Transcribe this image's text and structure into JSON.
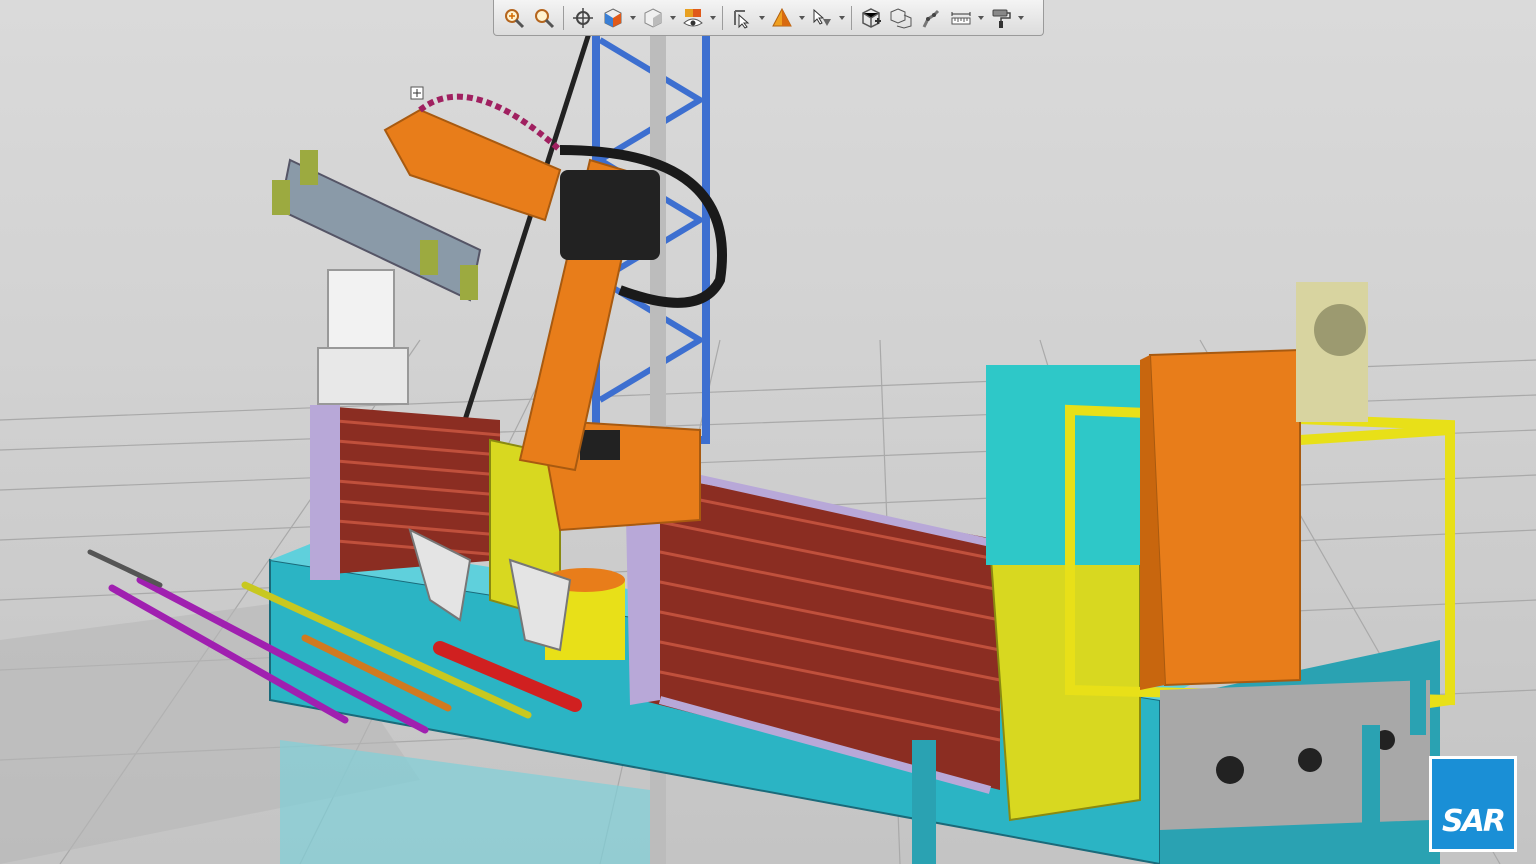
{
  "toolbar": {
    "buttons": [
      {
        "icon": "zoom-fit-icon"
      },
      {
        "icon": "zoom-icon"
      },
      {
        "icon": "center-view-icon"
      },
      {
        "icon": "view-cube-icon"
      },
      {
        "icon": "shading-cube-icon"
      },
      {
        "icon": "visibility-eye-icon"
      },
      {
        "icon": "select-pointer-icon"
      },
      {
        "icon": "render-cone-icon"
      },
      {
        "icon": "pick-filter-icon"
      },
      {
        "icon": "section-box-icon"
      },
      {
        "icon": "explode-box-icon"
      },
      {
        "icon": "robot-icon"
      },
      {
        "icon": "measure-ruler-icon"
      },
      {
        "icon": "paint-roller-icon"
      }
    ]
  },
  "logo": {
    "text": "SAR",
    "color": "#1a8fd6"
  },
  "colors": {
    "robot": "#e87d1a",
    "base": "#2bb4c4",
    "frame": "#e8e018",
    "crate_side": "#d8d820",
    "rods": "#a13a2a",
    "mast": "#3d6fd0"
  }
}
